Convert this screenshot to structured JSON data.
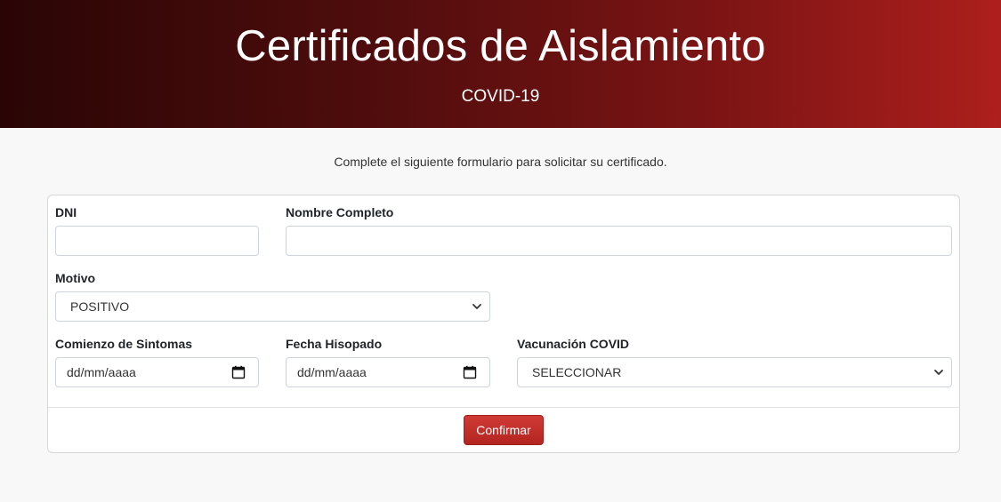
{
  "header": {
    "title": "Certificados de Aislamiento",
    "subtitle": "COVID-19"
  },
  "intro_text": "Complete el siguiente formulario para solicitar su certificado.",
  "form": {
    "dni": {
      "label": "DNI",
      "value": ""
    },
    "nombre": {
      "label": "Nombre Completo",
      "value": ""
    },
    "motivo": {
      "label": "Motivo",
      "selected": "POSITIVO"
    },
    "comienzo": {
      "label": "Comienzo de Sintomas",
      "placeholder": "dd/mm/aaaa"
    },
    "hisopado": {
      "label": "Fecha Hisopado",
      "placeholder": "dd/mm/aaaa"
    },
    "vacunacion": {
      "label": "Vacunación COVID",
      "selected": "SELECCIONAR"
    },
    "submit_label": "Confirmar"
  },
  "colors": {
    "header_start": "#2a0505",
    "header_end": "#ad1f1c",
    "button": "#c0302b"
  }
}
